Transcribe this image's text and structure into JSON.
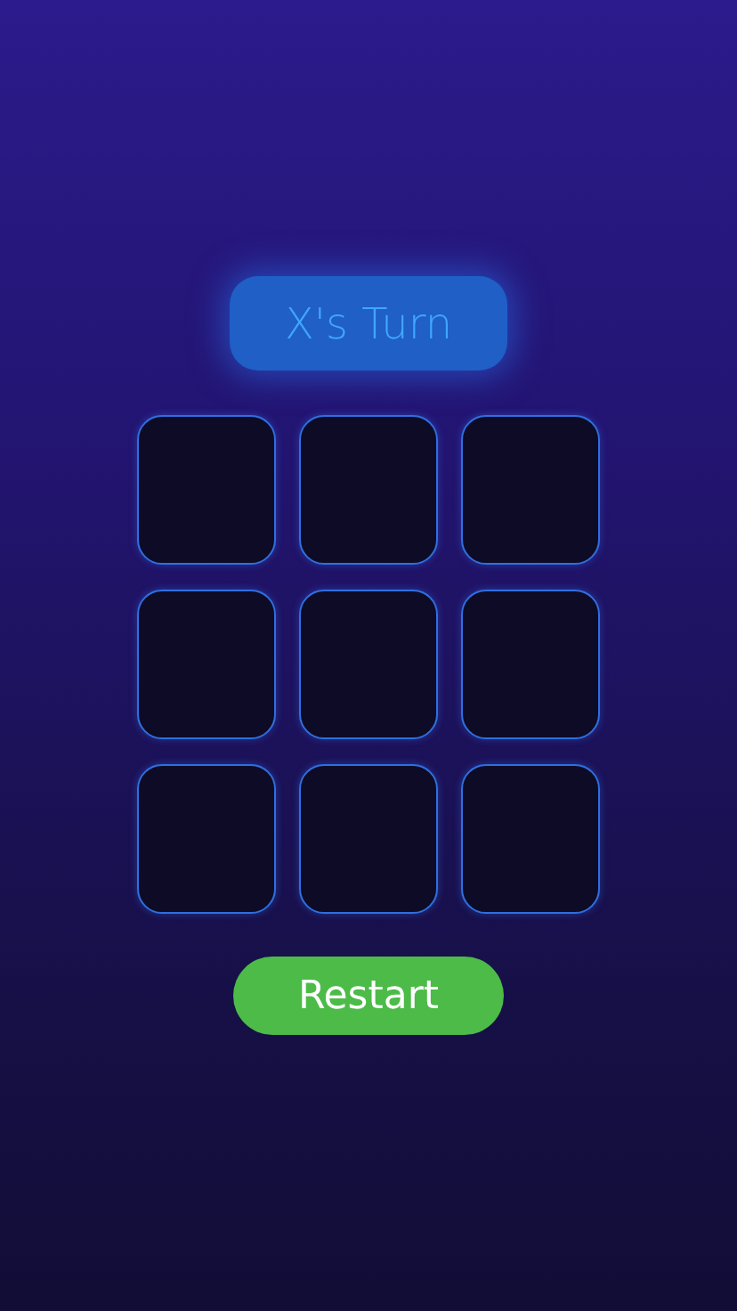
{
  "status": {
    "label": "X's Turn"
  },
  "board": {
    "cells": [
      {
        "kind": "empty"
      },
      {
        "kind": "empty"
      },
      {
        "kind": "empty"
      },
      {
        "kind": "empty"
      },
      {
        "kind": "empty"
      },
      {
        "kind": "empty"
      },
      {
        "kind": "empty"
      },
      {
        "kind": "empty"
      },
      {
        "kind": "empty"
      }
    ]
  },
  "restart_button": {
    "label": "Restart"
  }
}
